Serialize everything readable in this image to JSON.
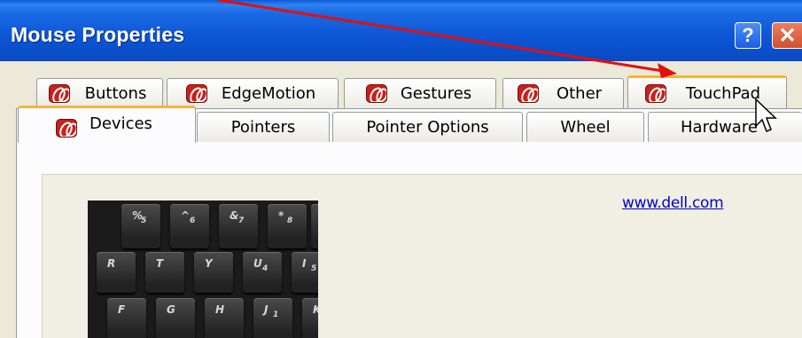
{
  "window": {
    "title": "Mouse Properties"
  },
  "title_buttons": {
    "help": "?",
    "close": "✕"
  },
  "tabs_row1": [
    {
      "label": "Buttons",
      "icon": "synaptics-logo-icon"
    },
    {
      "label": "EdgeMotion",
      "icon": "synaptics-logo-icon"
    },
    {
      "label": "Gestures",
      "icon": "synaptics-logo-icon"
    },
    {
      "label": "Other",
      "icon": "synaptics-logo-icon"
    },
    {
      "label": "TouchPad",
      "icon": "synaptics-logo-icon",
      "hover": true
    }
  ],
  "tabs_row2": [
    {
      "label": "Devices",
      "icon": "synaptics-logo-icon",
      "selected": true
    },
    {
      "label": "Pointers"
    },
    {
      "label": "Pointer Options"
    },
    {
      "label": "Wheel"
    },
    {
      "label": "Hardware"
    }
  ],
  "panel": {
    "link_text": "www.dell.com"
  },
  "keyboard_keys": [
    {
      "main": "%",
      "sub": "5"
    },
    {
      "main": "^",
      "sub": "6"
    },
    {
      "main": "&",
      "sub": "7"
    },
    {
      "main": "*",
      "sub": "8"
    },
    {
      "main": "R",
      "sub": ""
    },
    {
      "main": "T",
      "sub": ""
    },
    {
      "main": "Y",
      "sub": ""
    },
    {
      "main": "U",
      "sub": "4"
    },
    {
      "main": "I",
      "sub": "5"
    },
    {
      "main": "F",
      "sub": ""
    },
    {
      "main": "G",
      "sub": ""
    },
    {
      "main": "H",
      "sub": ""
    },
    {
      "main": "J",
      "sub": "1"
    },
    {
      "main": "K",
      "sub": ""
    }
  ],
  "colors": {
    "titlebar": "#0c55d4",
    "dialog_bg": "#ece9d8",
    "hot_tab_accent": "#f6b33a",
    "link": "#0000cc",
    "annotation_arrow": "#e01010"
  }
}
